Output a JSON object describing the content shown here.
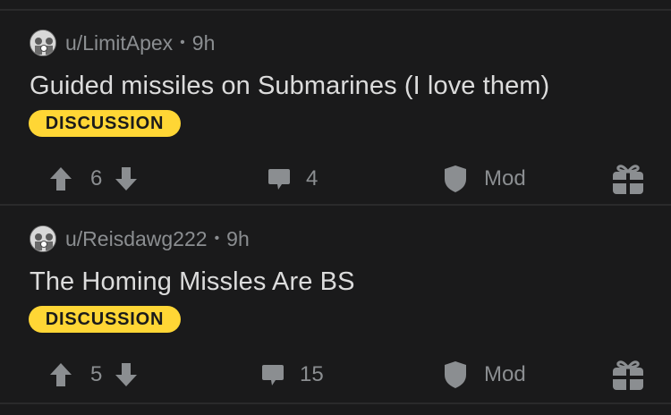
{
  "posts": [
    {
      "author": "u/LimitApex",
      "separator": "•",
      "age": "9h",
      "title": "Guided missiles on Submarines (I love them)",
      "flair": "DISCUSSION",
      "votes": "6",
      "comments": "4",
      "mod_label": "Mod"
    },
    {
      "author": "u/Reisdawg222",
      "separator": "•",
      "age": "9h",
      "title": "The Homing Missles Are BS",
      "flair": "DISCUSSION",
      "votes": "5",
      "comments": "15",
      "mod_label": "Mod"
    }
  ],
  "colors": {
    "background": "#1a1a1b",
    "flair": "#ffd635",
    "muted_text": "#8b8e91",
    "icon": "#8b8e91"
  },
  "icons": {
    "upvote": "arrow-up-icon",
    "downvote": "arrow-down-icon",
    "comment": "comment-bubble-icon",
    "mod": "shield-icon",
    "gift": "gift-icon"
  }
}
